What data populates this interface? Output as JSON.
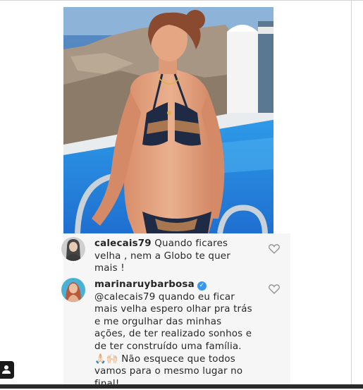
{
  "comments": [
    {
      "username": "calecais79",
      "text": "Quando ficares\nvelha , nem a Globo te quer\nmais !",
      "verified": false
    },
    {
      "username": "marinaruybarbosa",
      "text": "@calecais79 quando eu ficar\nmais velha espero olhar pra trás\ne me orgulhar das minhas\nações, de ter realizado sonhos e\nde ter construído uma família.\n🙏🏻🙌🏻 Não esquece que todos\nvamos para o mesmo lugar no\nfinal!",
      "verified": true
    }
  ],
  "icons": {
    "heart": "heart-icon",
    "verified": "verified-badge-icon",
    "profile": "profile-icon"
  },
  "colors": {
    "comment_bg": "#f6f6f6",
    "verified_blue": "#3897f0",
    "pool_blue": "#1f7fd9"
  }
}
